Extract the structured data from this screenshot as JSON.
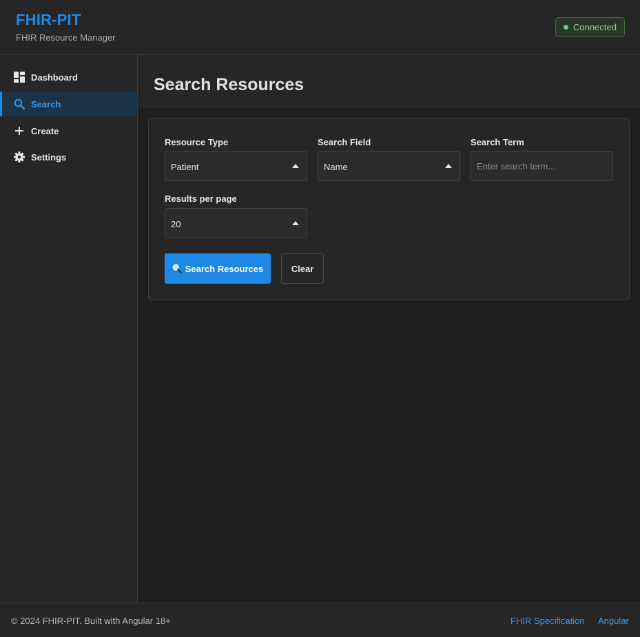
{
  "header": {
    "title": "FHIR-PIT",
    "subtitle": "FHIR Resource Manager",
    "status": "Connected",
    "status_color": "#6fcf6f"
  },
  "sidebar": {
    "items": [
      {
        "label": "Dashboard",
        "icon": "dashboard-icon",
        "active": false
      },
      {
        "label": "Search",
        "icon": "search-icon",
        "active": true
      },
      {
        "label": "Create",
        "icon": "plus-icon",
        "active": false
      },
      {
        "label": "Settings",
        "icon": "gear-icon",
        "active": false
      }
    ]
  },
  "main": {
    "title": "Search Resources",
    "form": {
      "resource_type_label": "Resource Type",
      "resource_type_value": "Patient",
      "search_field_label": "Search Field",
      "search_field_value": "Name",
      "search_term_label": "Search Term",
      "search_term_value": "",
      "search_term_placeholder": "Enter search term...",
      "results_per_page_label": "Results per page",
      "results_per_page_value": "20"
    },
    "buttons": {
      "search_label": "Search Resources",
      "clear_label": "Clear"
    }
  },
  "footer": {
    "copyright": "© 2024 FHIR-PIT. Built with Angular 18+",
    "links": [
      "FHIR Specification",
      "Angular"
    ]
  },
  "colors": {
    "accent": "#1e88e5",
    "background": "#1f1f1f",
    "surface": "#262626"
  }
}
